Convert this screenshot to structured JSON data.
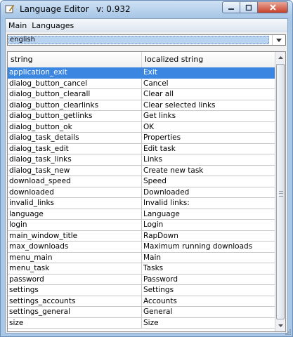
{
  "window": {
    "title": "Language Editor",
    "version": "v: 0.932",
    "minimize_glyph": "—",
    "maximize_glyph": "☐",
    "close_glyph": "✕"
  },
  "menu": [
    {
      "label": "Main"
    },
    {
      "label": "Languages"
    }
  ],
  "language_select": {
    "value": "english"
  },
  "table": {
    "columns": [
      "string",
      "localized string"
    ],
    "rows": [
      {
        "key": "application_exit",
        "value": "Exit",
        "selected": true
      },
      {
        "key": "dialog_button_cancel",
        "value": "Cancel"
      },
      {
        "key": "dialog_button_clearall",
        "value": "Clear all"
      },
      {
        "key": "dialog_button_clearlinks",
        "value": "Clear selected links"
      },
      {
        "key": "dialog_button_getlinks",
        "value": "Get links"
      },
      {
        "key": "dialog_button_ok",
        "value": "OK"
      },
      {
        "key": "dialog_task_details",
        "value": "Properties"
      },
      {
        "key": "dialog_task_edit",
        "value": "Edit task"
      },
      {
        "key": "dialog_task_links",
        "value": "Links"
      },
      {
        "key": "dialog_task_new",
        "value": "Create new task"
      },
      {
        "key": "download_speed",
        "value": "Speed"
      },
      {
        "key": "downloaded",
        "value": "Downloaded"
      },
      {
        "key": "invalid_links",
        "value": "Invalid links:"
      },
      {
        "key": "language",
        "value": "Language"
      },
      {
        "key": "login",
        "value": "Login"
      },
      {
        "key": "main_window_title",
        "value": "RapDown"
      },
      {
        "key": "max_downloads",
        "value": "Maximum running downloads"
      },
      {
        "key": "menu_main",
        "value": "Main"
      },
      {
        "key": "menu_task",
        "value": "Tasks"
      },
      {
        "key": "password",
        "value": "Password"
      },
      {
        "key": "settings",
        "value": "Settings"
      },
      {
        "key": "settings_accounts",
        "value": "Accounts"
      },
      {
        "key": "settings_general",
        "value": "General"
      },
      {
        "key": "size",
        "value": "Size"
      }
    ]
  },
  "colors": {
    "selection": "#3b86e0",
    "titlebar": "#a9c8e8",
    "close_button": "#c8412a"
  }
}
